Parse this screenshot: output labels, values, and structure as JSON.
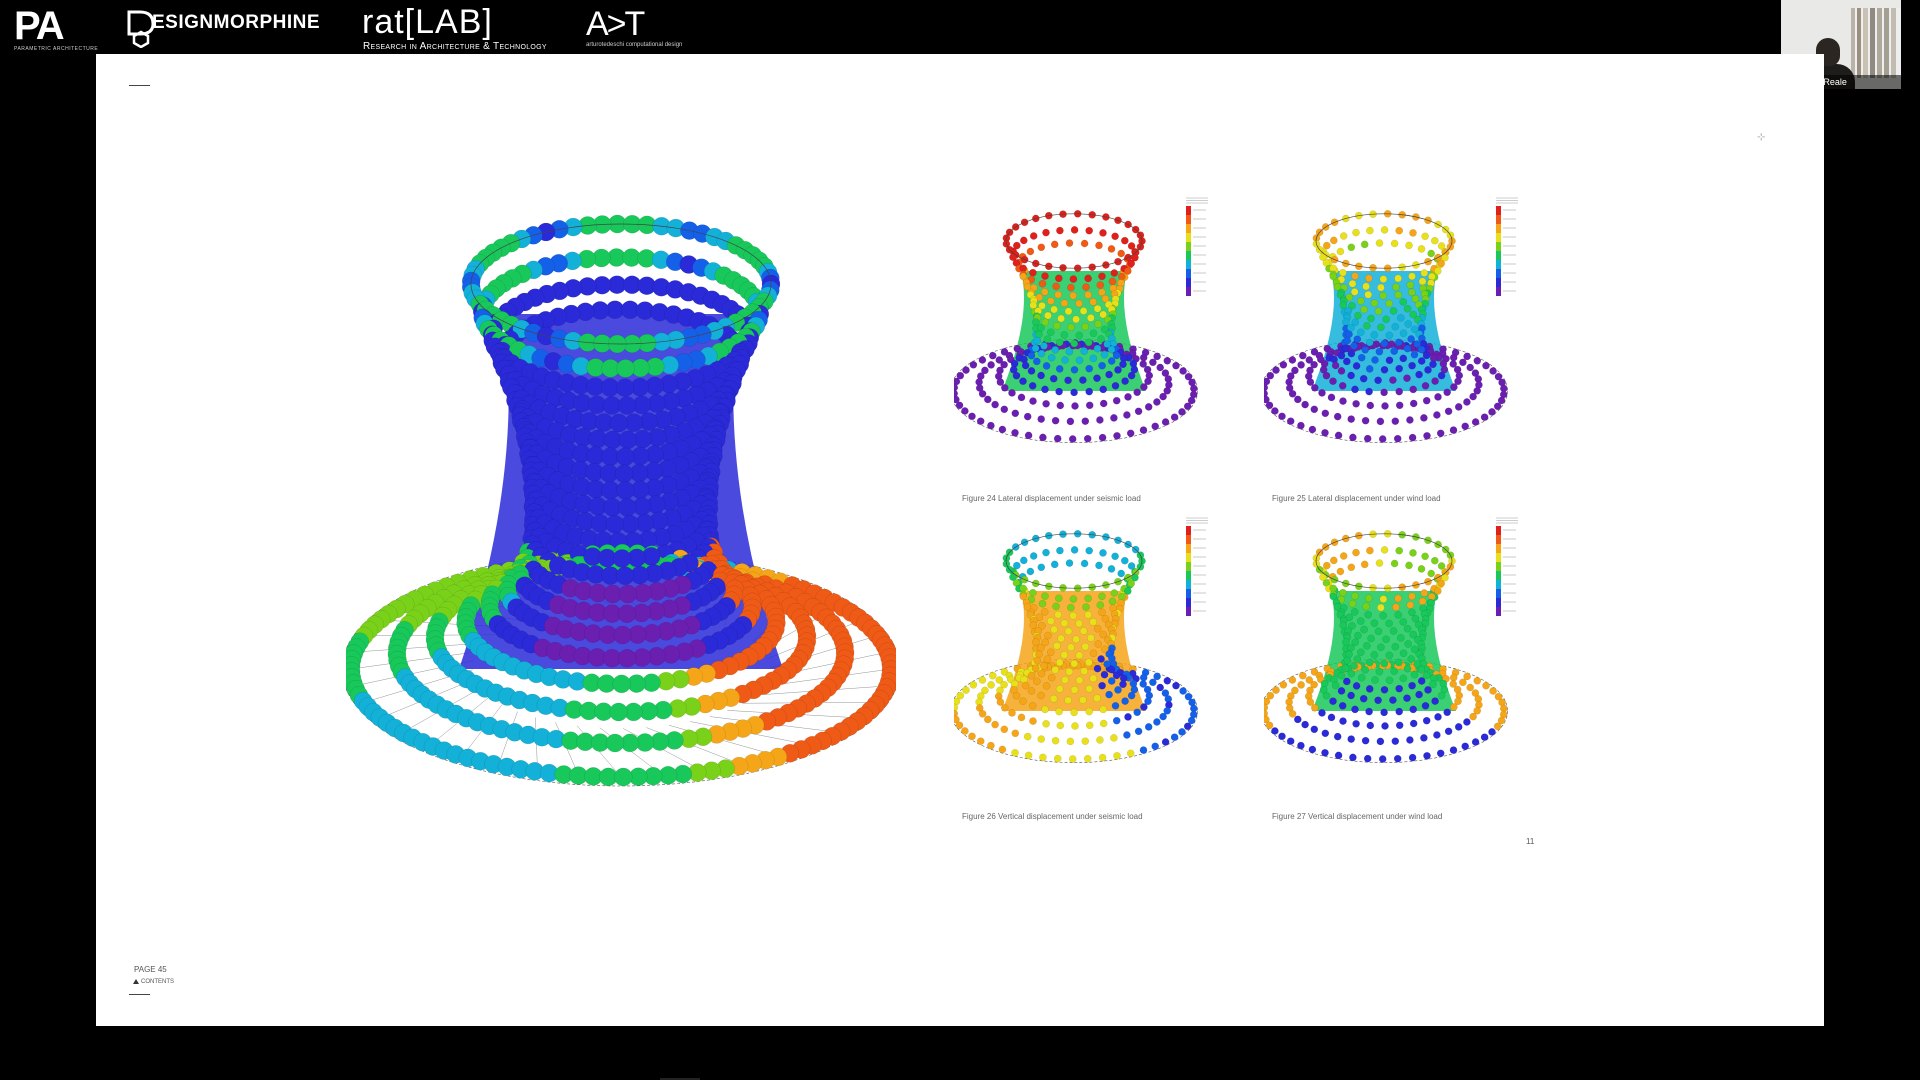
{
  "header": {
    "logos": [
      {
        "text": "PA",
        "sub": "PARAMETRIC ARCHITECTURE"
      },
      {
        "text": "ESIGNMORPHINE"
      },
      {
        "text": "rat[LAB]",
        "sub": "Research in Architecture & Technology"
      },
      {
        "text": "A>T",
        "sub": "arturotedeschi computational design"
      }
    ]
  },
  "video": {
    "participant_name": "Vincenzo Reale"
  },
  "slide": {
    "cornermark": "⊹",
    "figures": [
      {
        "caption": "Figure 24 Lateral displacement under seismic load"
      },
      {
        "caption": "Figure 25 Lateral displacement under wind load"
      },
      {
        "caption": "Figure 26 Vertical displacement under seismic load"
      },
      {
        "caption": "Figure 27 Vertical displacement under wind load"
      }
    ],
    "page_number": "11",
    "page_label": "PAGE 45",
    "contents_label": "CONTENTS"
  },
  "colors": {
    "background": "#000000",
    "slide": "#ffffff",
    "ramp": [
      "#6a1fb0",
      "#2a2ad8",
      "#1560e8",
      "#13b0d8",
      "#18c85a",
      "#7ad11a",
      "#e8e01a",
      "#f5a518",
      "#ef5a16",
      "#e0201a"
    ]
  }
}
